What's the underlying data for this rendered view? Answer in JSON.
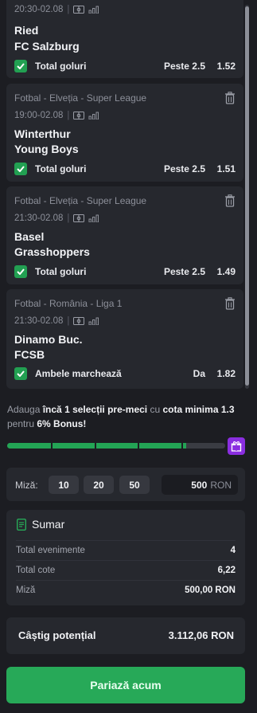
{
  "bets": [
    {
      "league": "",
      "datetime": "20:30-02.08",
      "home": "Ried",
      "away": "FC Salzburg",
      "market": "Total goluri",
      "pick": "Peste 2.5",
      "odds": "1.52"
    },
    {
      "league": "Fotbal - Elveția - Super League",
      "datetime": "19:00-02.08",
      "home": "Winterthur",
      "away": "Young Boys",
      "market": "Total goluri",
      "pick": "Peste 2.5",
      "odds": "1.51"
    },
    {
      "league": "Fotbal - Elveția - Super League",
      "datetime": "21:30-02.08",
      "home": "Basel",
      "away": "Grasshoppers",
      "market": "Total goluri",
      "pick": "Peste 2.5",
      "odds": "1.49"
    },
    {
      "league": "Fotbal - România - Liga 1",
      "datetime": "21:30-02.08",
      "home": "Dinamo Buc.",
      "away": "FCSB",
      "market": "Ambele marchează",
      "pick": "Da",
      "odds": "1.82"
    }
  ],
  "promo": {
    "t1": "Adauga ",
    "b1": "încă 1 selecții pre-meci",
    "t2": " cu ",
    "b2": "cota minima 1.3",
    "t3": " pentru ",
    "b3": "6% Bonus",
    "t4": "!",
    "progress": 0.82,
    "segments": 5
  },
  "stake": {
    "label": "Miză:",
    "quick": [
      "10",
      "20",
      "50"
    ],
    "amount": "500",
    "currency": "RON"
  },
  "summary": {
    "title": "Sumar",
    "rows": [
      {
        "label": "Total evenimente",
        "value": "4"
      },
      {
        "label": "Total cote",
        "value": "6,22"
      },
      {
        "label": "Miză",
        "value": "500,00 RON"
      }
    ]
  },
  "payout": {
    "label": "Câștig potențial",
    "value": "3.112,06 RON"
  },
  "cta": {
    "label": "Pariază acum"
  },
  "colors": {
    "accent": "#27a958",
    "gift": "#8a2ee0",
    "background": "#1c1d22",
    "card": "#26282e"
  },
  "icons": [
    "trash-icon",
    "checkbox-checked-icon",
    "live-tv-icon",
    "stats-icon",
    "gift-icon",
    "summary-doc-icon"
  ]
}
